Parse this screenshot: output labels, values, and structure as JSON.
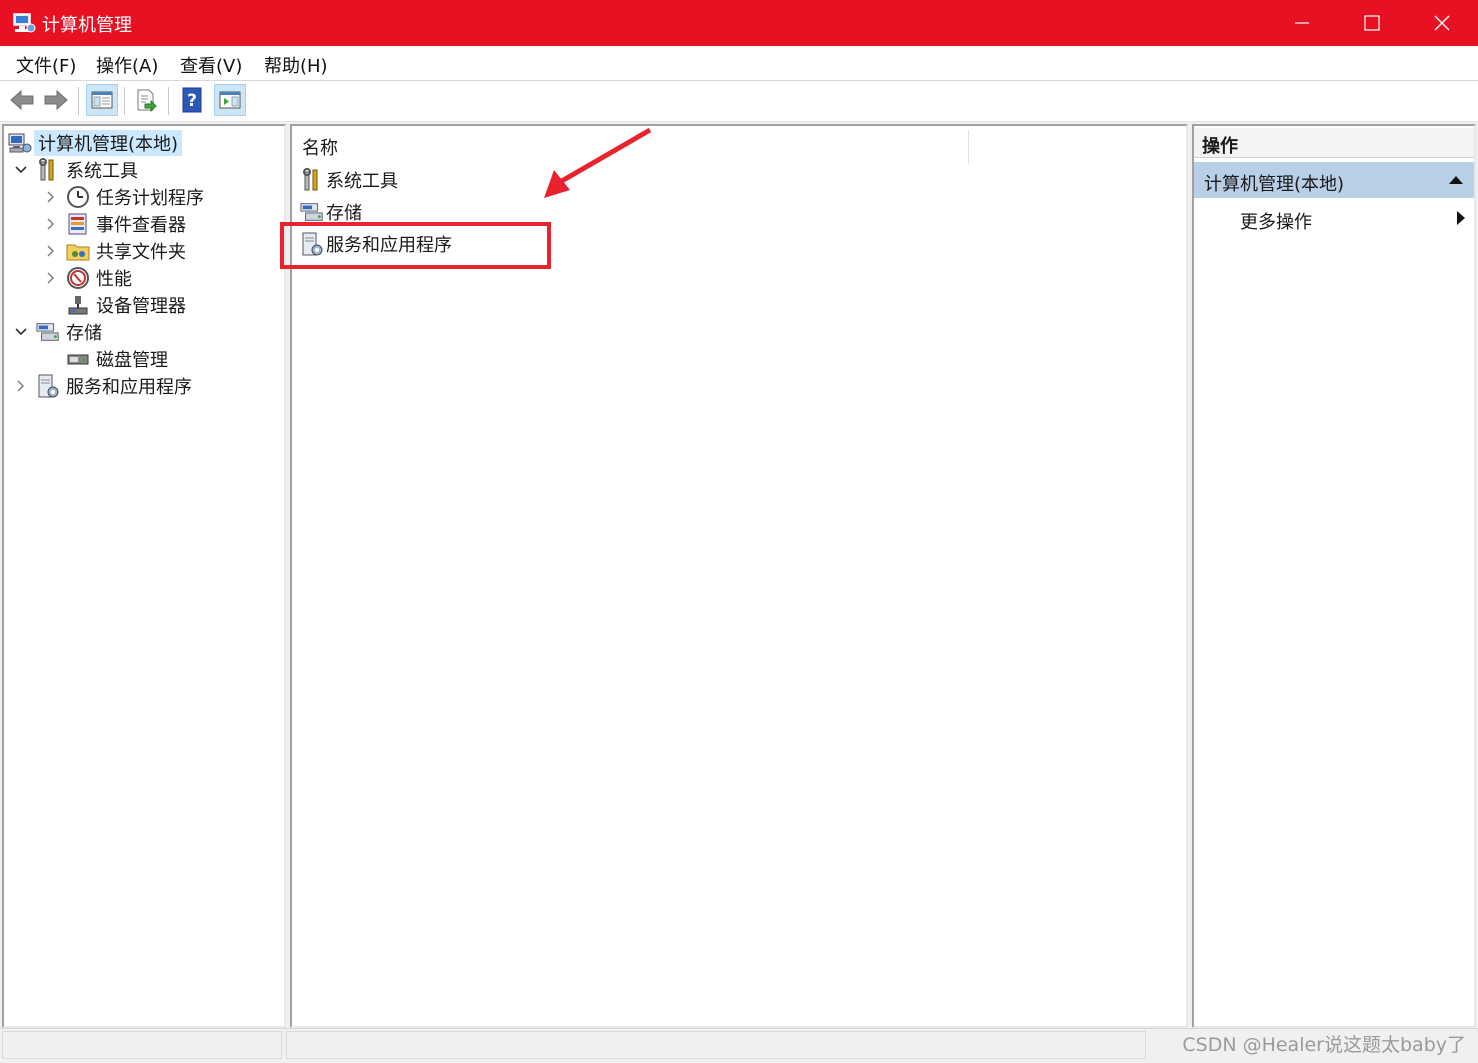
{
  "window": {
    "title": "计算机管理",
    "controls": [
      "minimize",
      "maximize",
      "close"
    ]
  },
  "menu": [
    "文件(F)",
    "操作(A)",
    "查看(V)",
    "帮助(H)"
  ],
  "toolbar": {
    "buttons": [
      "back-icon",
      "forward-icon",
      "show-hide-console-tree-icon",
      "export-list-icon",
      "help-icon",
      "show-hide-action-pane-icon"
    ]
  },
  "tree": {
    "root": "计算机管理(本地)",
    "system_tools": "系统工具",
    "task_scheduler": "任务计划程序",
    "event_viewer": "事件查看器",
    "shared_folders": "共享文件夹",
    "performance": "性能",
    "device_manager": "设备管理器",
    "storage": "存储",
    "disk_management": "磁盘管理",
    "services_apps": "服务和应用程序"
  },
  "list": {
    "column_name": "名称",
    "items": [
      "系统工具",
      "存储",
      "服务和应用程序"
    ]
  },
  "actions": {
    "header": "操作",
    "section": "计算机管理(本地)",
    "more": "更多操作"
  },
  "watermark": "CSDN @Healer说这题太baby了",
  "colors": {
    "titlebar": "#e81123",
    "annotation": "#e8232e",
    "selection": "#cce8ff",
    "actions_section": "#b8cfe6"
  }
}
